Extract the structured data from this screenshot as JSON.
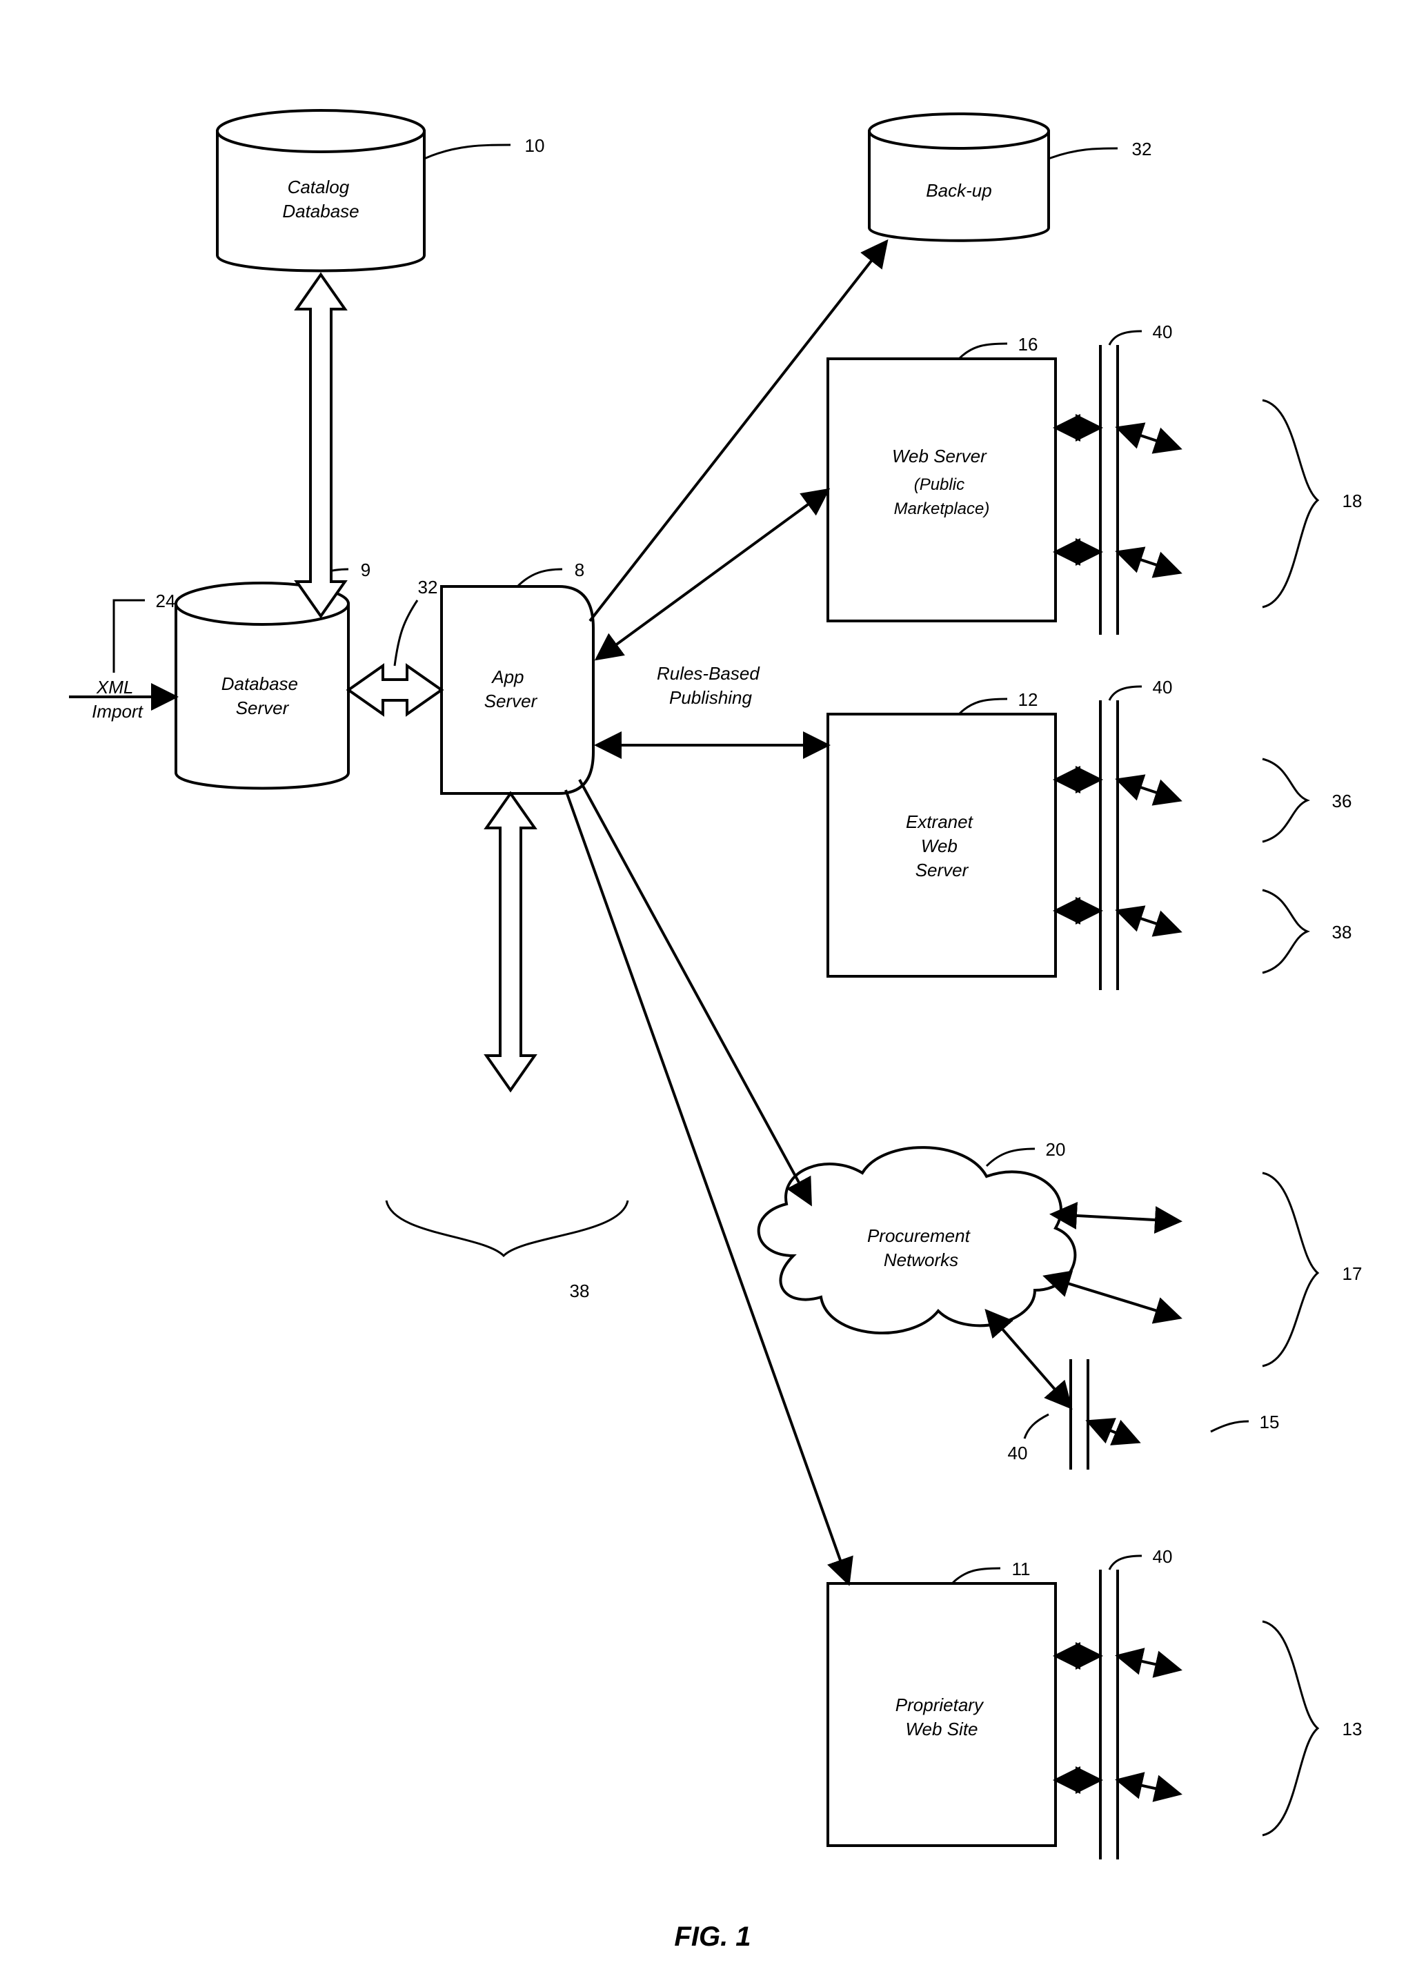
{
  "figure_label": "FIG. 1",
  "nodes": {
    "catalog_db": {
      "text": "Catalog\nDatabase",
      "ref": "10"
    },
    "db_server": {
      "text": "Database\nServer",
      "ref": "9"
    },
    "app_server": {
      "text": "App\nServer",
      "ref": "8"
    },
    "xml_import": {
      "text": "XML\nImport",
      "ref": "24"
    },
    "backup": {
      "text": "Back-up",
      "ref": "32"
    },
    "web_server": {
      "text": "Web Server\n(Public\nMarketplace)",
      "ref": "16"
    },
    "extranet": {
      "text": "Extranet\nWeb\nServer",
      "ref": "12"
    },
    "procurement": {
      "text": "Procurement\nNetworks",
      "ref": "20"
    },
    "proprietary": {
      "text": "Proprietary\nWeb Site",
      "ref": "11"
    },
    "rules_label": {
      "text": "Rules-Based\nPublishing"
    }
  },
  "refs_extra": {
    "app_db_open_arrow": "32",
    "firewall_ws": "40",
    "firewall_ex": "40",
    "firewall_pn": "40",
    "firewall_pr": "40",
    "clients_ws": "18",
    "clients_ex_top": "36",
    "clients_ex_bot": "38",
    "clients_pn": "17",
    "client_pn_single": "15",
    "clients_pr": "13",
    "bottom_clients": "38"
  }
}
